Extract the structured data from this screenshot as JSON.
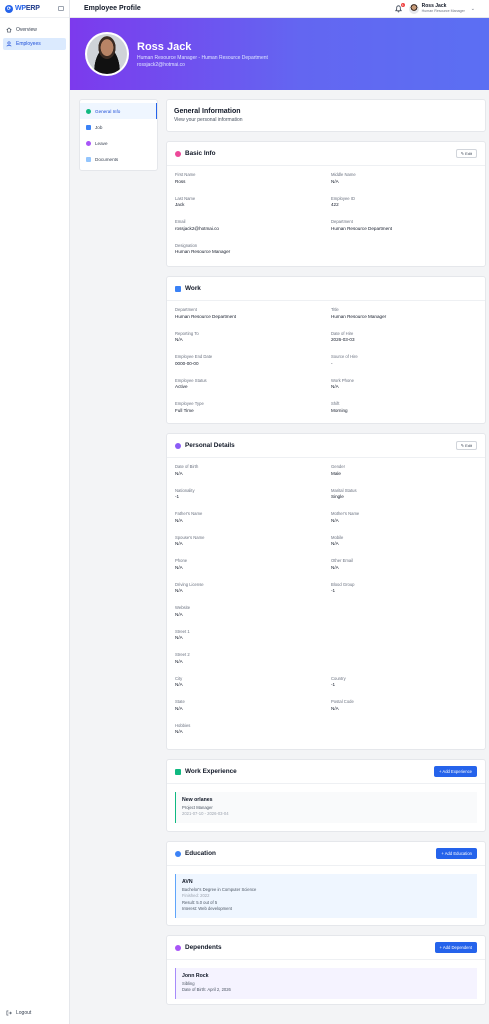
{
  "app": {
    "logo_text": "WP",
    "logo_text2": "ERP",
    "page_title": "Employee Profile"
  },
  "sidebar": {
    "items": [
      {
        "label": "Overview"
      },
      {
        "label": "Employees"
      }
    ],
    "logout": "Logout"
  },
  "topbar": {
    "notifications_badge": "1",
    "user_name": "Ross Jack",
    "user_role": "Human Resource Manager"
  },
  "profile": {
    "name": "Ross Jack",
    "subtitle": "Human Resource Manager - Human Resource Department",
    "email": "rossjack2@hotmai.co"
  },
  "tabs": [
    {
      "label": "General Info"
    },
    {
      "label": "Job"
    },
    {
      "label": "Leave"
    },
    {
      "label": "Documents"
    }
  ],
  "general": {
    "title": "General Information",
    "subtitle": "View your personal information"
  },
  "edit_label": "Edit",
  "basic_info": {
    "title": "Basic Info",
    "fields": [
      {
        "label": "First Name",
        "value": "Ross"
      },
      {
        "label": "Middle Name",
        "value": "N/A"
      },
      {
        "label": "Last Name",
        "value": "Jack"
      },
      {
        "label": "Employee ID",
        "value": "422"
      },
      {
        "label": "Email",
        "value": "rossjack2@hotmai.co"
      },
      {
        "label": "Department",
        "value": "Human Resource Department"
      },
      {
        "label": "Designation",
        "value": "Human Resource Manager"
      }
    ]
  },
  "work": {
    "title": "Work",
    "fields": [
      {
        "label": "Department",
        "value": "Human Resource Department"
      },
      {
        "label": "Title",
        "value": "Human Resource Manager"
      },
      {
        "label": "Reporting To",
        "value": "N/A"
      },
      {
        "label": "Date of Hire",
        "value": "2026-03-03"
      },
      {
        "label": "Employee End Date",
        "value": "0000-00-00"
      },
      {
        "label": "Source of Hire",
        "value": "-"
      },
      {
        "label": "Employee Status",
        "value": "Active"
      },
      {
        "label": "Work Phone",
        "value": "N/A"
      },
      {
        "label": "Employee Type",
        "value": "Full Time"
      },
      {
        "label": "Shift",
        "value": "Morning"
      }
    ]
  },
  "personal": {
    "title": "Personal Details",
    "fields": [
      {
        "label": "Date of Birth",
        "value": "N/A"
      },
      {
        "label": "Gender",
        "value": "Male"
      },
      {
        "label": "Nationality",
        "value": "-1"
      },
      {
        "label": "Marital Status",
        "value": "Single"
      },
      {
        "label": "Father's Name",
        "value": "N/A"
      },
      {
        "label": "Mother's Name",
        "value": "N/A"
      },
      {
        "label": "Spouse's Name",
        "value": "N/A"
      },
      {
        "label": "Mobile",
        "value": "N/A"
      },
      {
        "label": "Phone",
        "value": "N/A"
      },
      {
        "label": "Other Email",
        "value": "N/A"
      },
      {
        "label": "Driving License",
        "value": "N/A"
      },
      {
        "label": "Blood Group",
        "value": "-1"
      },
      {
        "label": "Website",
        "value": "N/A"
      },
      {
        "label": "",
        "value": ""
      },
      {
        "label": "Street 1",
        "value": "N/A"
      },
      {
        "label": "",
        "value": ""
      },
      {
        "label": "Street 2",
        "value": "N/A"
      },
      {
        "label": "",
        "value": ""
      },
      {
        "label": "City",
        "value": "N/A"
      },
      {
        "label": "Country",
        "value": "-1"
      },
      {
        "label": "State",
        "value": "N/A"
      },
      {
        "label": "Postal Code",
        "value": "N/A"
      },
      {
        "label": "Hobbies",
        "value": "N/A"
      }
    ]
  },
  "experience": {
    "title": "Work Experience",
    "button": "+ Add Experience",
    "item": {
      "company": "New orlanes",
      "role": "Project Manager",
      "dates": "2021-07-10 - 2026-03-04"
    }
  },
  "education": {
    "title": "Education",
    "button": "+ Add Education",
    "item": {
      "school": "AVN",
      "degree": "Bachelor's Degree in Computer Science",
      "finished": "Finished: 2022",
      "result": "Result: 5.0 out of 5",
      "interest": "Interest: Web development"
    }
  },
  "dependents": {
    "title": "Dependents",
    "button": "+ Add Dependent",
    "item": {
      "name": "Jonn Rock",
      "relation": "Sibling",
      "dob": "Date of Birth: April 2, 2026"
    }
  },
  "colors": {
    "accent": "#2563eb",
    "banner_from": "#7c3aed",
    "banner_to": "#5b6ff3"
  }
}
